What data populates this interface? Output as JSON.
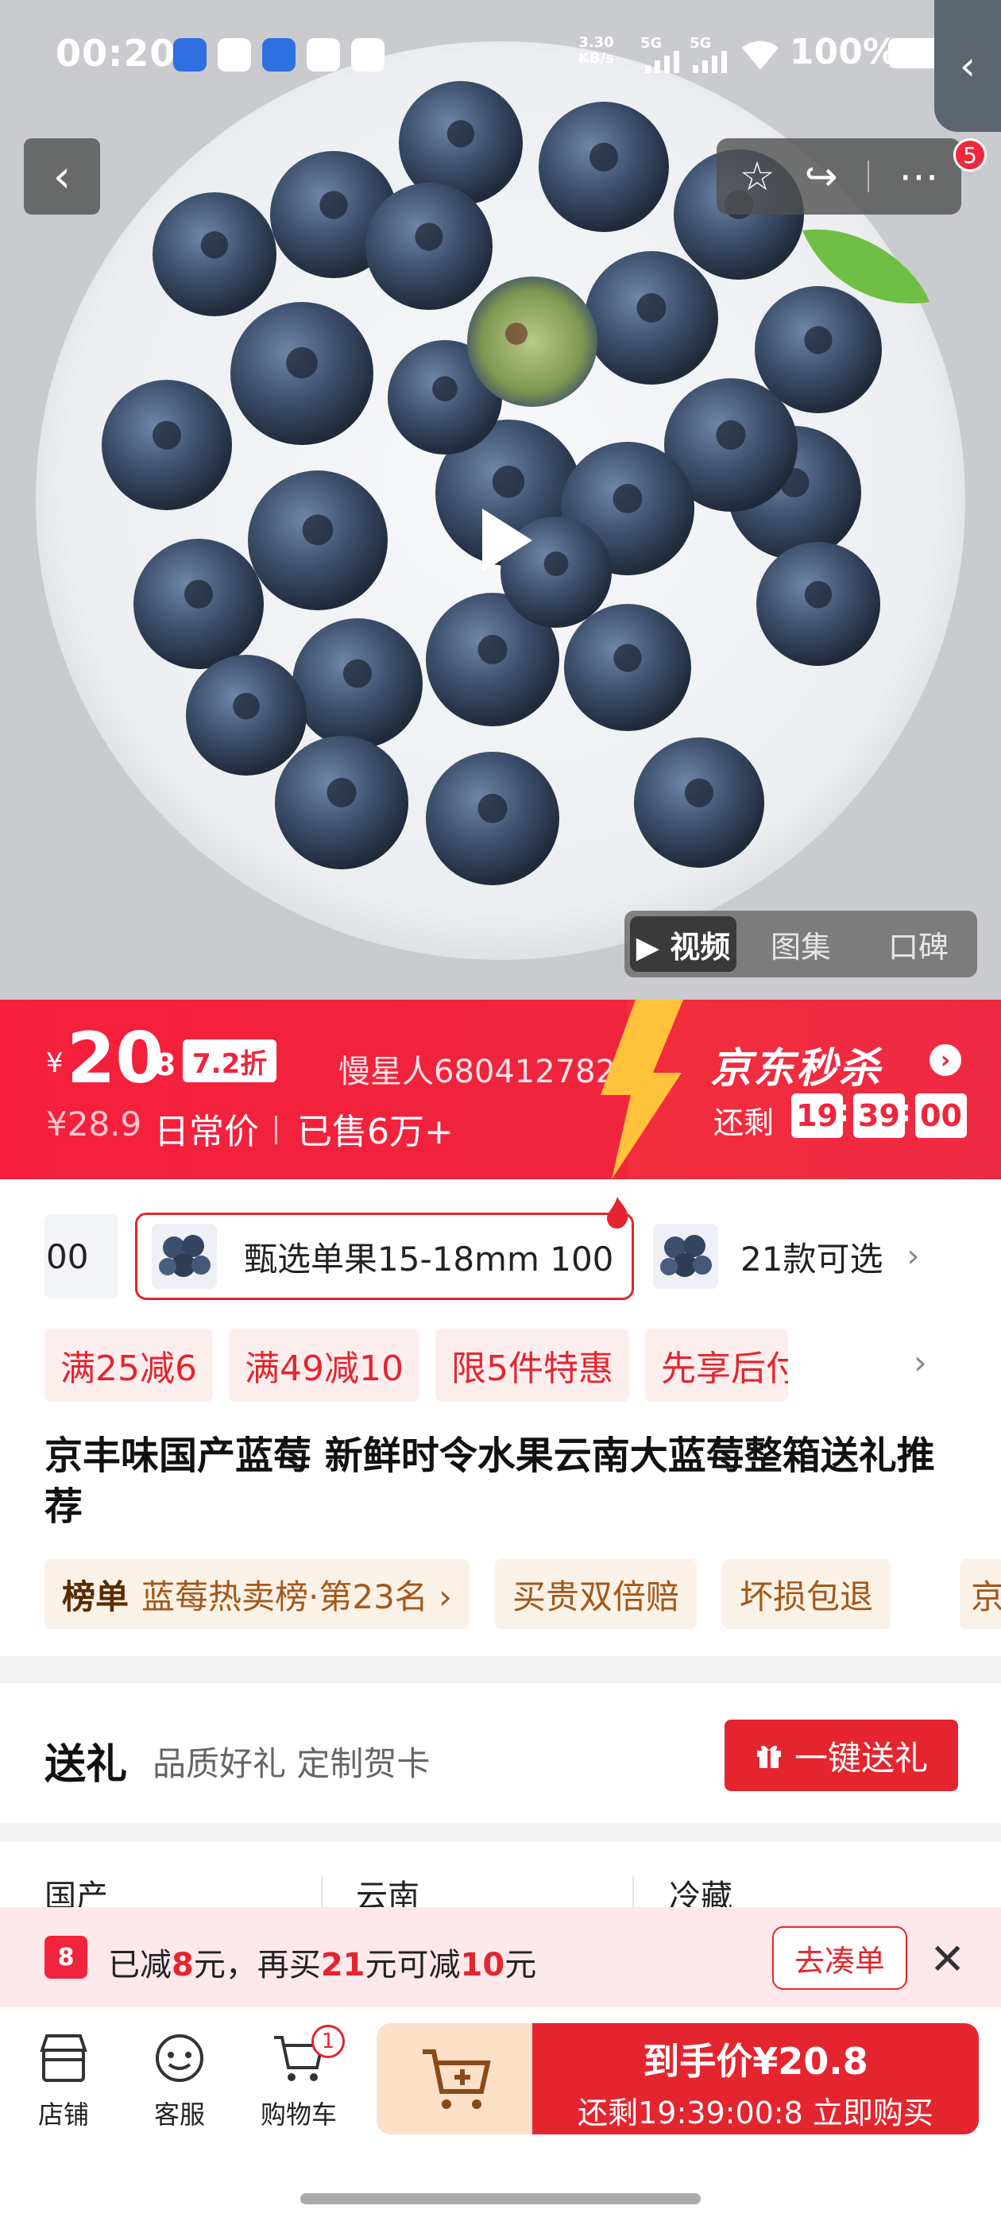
{
  "status_bar": {
    "time": "00:20",
    "net_speed_value": "3.30",
    "net_speed_unit": "KB/s",
    "signal1": "5G",
    "signal2": "5G",
    "battery": "100%"
  },
  "hero": {
    "media_tabs": [
      {
        "label": "▶ 视频",
        "active": true
      },
      {
        "label": "图集",
        "active": false
      },
      {
        "label": "口碑",
        "active": false
      }
    ],
    "notification_count": "5"
  },
  "price": {
    "currency": "¥",
    "int": "20",
    "dec": ".8",
    "discount": "7.2折",
    "user": "慢星人680412782",
    "original": "¥28.9",
    "daily_label": "日常价",
    "sold": "已售6万+",
    "flash_title": "京东秒杀",
    "remain_label": "还剩",
    "countdown": {
      "h": "19",
      "m": "39",
      "s": "00"
    }
  },
  "variants": {
    "partial_label": "00",
    "selected_label": "甄选单果15-18mm 100",
    "more_label": "21款可选"
  },
  "promotions": [
    "满25减6",
    "满49减10",
    "限5件特惠",
    "先享后付"
  ],
  "product_title": "京丰味国产蓝莓 新鲜时令水果云南大蓝莓整箱送礼推荐",
  "tags": {
    "rank_label": "榜单",
    "rank_value": "蓝莓热卖榜·第23名 ›",
    "t2": "买贵双倍赔",
    "t3": "坏损包退",
    "t4": "京"
  },
  "gift": {
    "title": "送礼",
    "subtitle": "品质好礼 定制贺卡",
    "button": "一键送礼"
  },
  "specs": [
    "国产",
    "云南",
    "冷藏"
  ],
  "discount_bar": {
    "p1": "已减",
    "v1": "8",
    "p2": "元，再买",
    "v2": "21",
    "p3": "元可减",
    "v3": "10",
    "p4": "元",
    "go_button": "去凑单"
  },
  "bottom_nav": {
    "store": "店铺",
    "service": "客服",
    "cart": "购物车",
    "cart_count": "1",
    "buy_line1": "到手价¥20.8",
    "buy_line2": "还剩19:39:00:8 立即购买"
  }
}
